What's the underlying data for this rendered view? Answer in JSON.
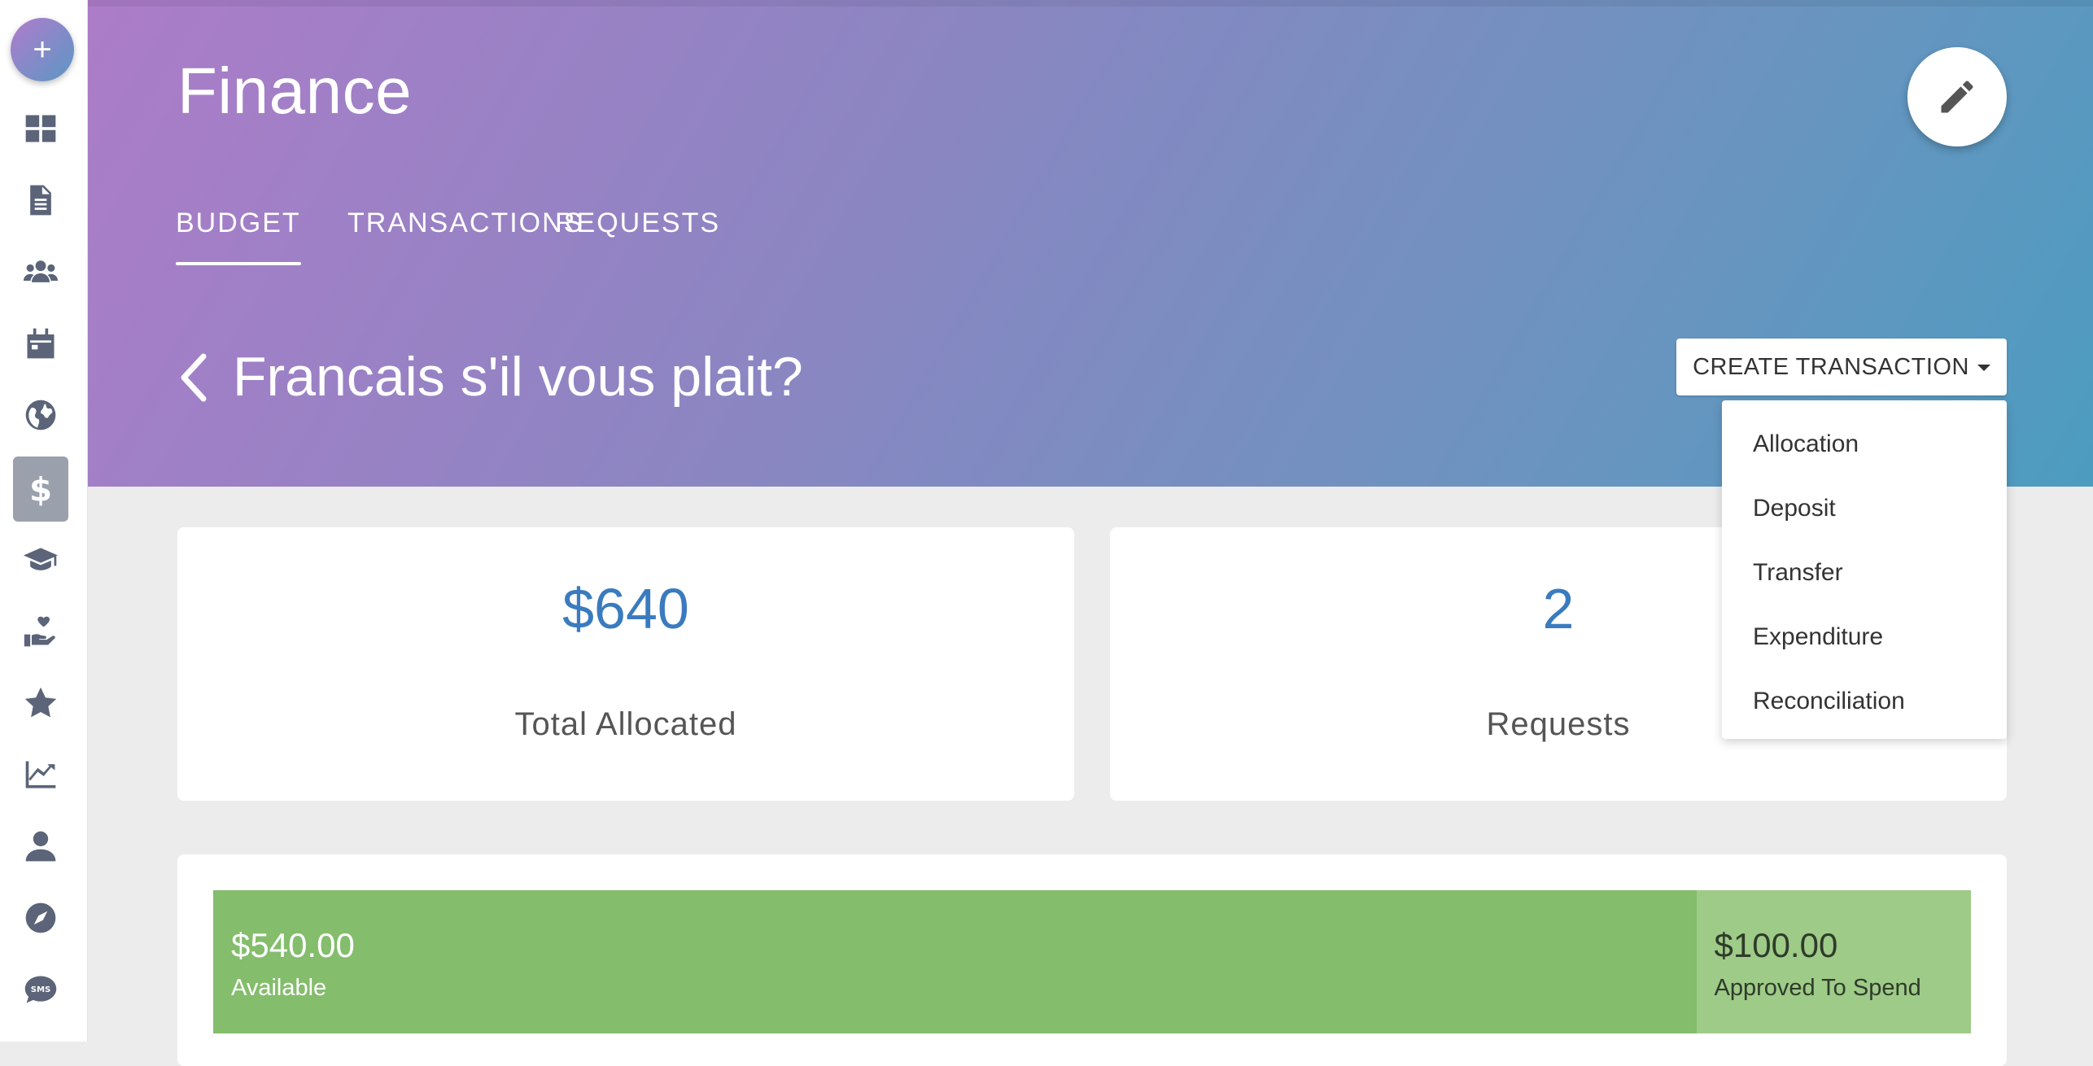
{
  "sidebar": {
    "add_label": "+",
    "items": [
      {
        "icon": "dashboard-icon"
      },
      {
        "icon": "document-icon"
      },
      {
        "icon": "users-icon"
      },
      {
        "icon": "calendar-icon"
      },
      {
        "icon": "globe-icon"
      },
      {
        "icon": "dollar-icon",
        "active": true
      },
      {
        "icon": "graduation-cap-icon"
      },
      {
        "icon": "hand-heart-icon"
      },
      {
        "icon": "star-icon"
      },
      {
        "icon": "chart-line-icon"
      },
      {
        "icon": "user-icon"
      },
      {
        "icon": "compass-icon"
      },
      {
        "icon": "sms-icon"
      }
    ]
  },
  "header": {
    "title": "Finance",
    "tabs": [
      {
        "label": "BUDGET",
        "active": true
      },
      {
        "label": "TRANSACTIONS"
      },
      {
        "label": "REQUESTS"
      }
    ],
    "budget_name": "Francais s'il vous plait?",
    "create_button": "CREATE TRANSACTION"
  },
  "dropdown": {
    "items": [
      "Allocation",
      "Deposit",
      "Transfer",
      "Expenditure",
      "Reconciliation"
    ]
  },
  "stats": {
    "allocated": {
      "value": "$640",
      "label": "Total Allocated"
    },
    "requests": {
      "value": "2",
      "label": "Requests"
    }
  },
  "budget_bar": {
    "available": {
      "amount": "$540.00",
      "label": "Available",
      "value": 540
    },
    "approved": {
      "amount": "$100.00",
      "label": "Approved To Spend",
      "value": 100
    }
  },
  "colors": {
    "accent_blue": "#3a7bbf",
    "available_green": "#84bd6c",
    "approved_green": "#9ecb88"
  }
}
